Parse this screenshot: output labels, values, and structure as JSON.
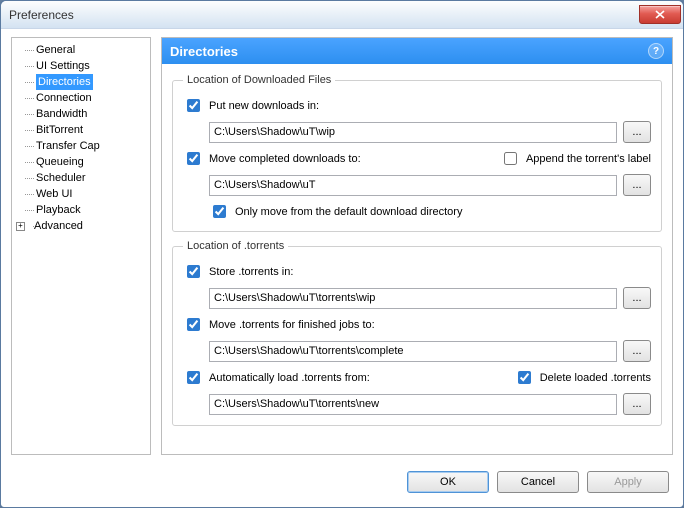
{
  "window": {
    "title": "Preferences"
  },
  "sidebar": {
    "items": [
      {
        "label": "General"
      },
      {
        "label": "UI Settings"
      },
      {
        "label": "Directories",
        "selected": true
      },
      {
        "label": "Connection"
      },
      {
        "label": "Bandwidth"
      },
      {
        "label": "BitTorrent"
      },
      {
        "label": "Transfer Cap"
      },
      {
        "label": "Queueing"
      },
      {
        "label": "Scheduler"
      },
      {
        "label": "Web UI"
      },
      {
        "label": "Playback"
      },
      {
        "label": "Advanced",
        "expandable": true
      }
    ]
  },
  "header": {
    "title": "Directories"
  },
  "section1": {
    "legend": "Location of Downloaded Files",
    "put_new": {
      "label": "Put new downloads in:",
      "checked": true
    },
    "put_new_path": "C:\\Users\\Shadow\\uT\\wip",
    "move_done": {
      "label": "Move completed downloads to:",
      "checked": true
    },
    "append_label": {
      "label": "Append the torrent's label",
      "checked": false
    },
    "move_done_path": "C:\\Users\\Shadow\\uT",
    "only_move": {
      "label": "Only move from the default download directory",
      "checked": true
    }
  },
  "section2": {
    "legend": "Location of .torrents",
    "store": {
      "label": "Store .torrents in:",
      "checked": true
    },
    "store_path": "C:\\Users\\Shadow\\uT\\torrents\\wip",
    "move_fin": {
      "label": "Move .torrents for finished jobs to:",
      "checked": true
    },
    "move_fin_path": "C:\\Users\\Shadow\\uT\\torrents\\complete",
    "auto_load": {
      "label": "Automatically load .torrents from:",
      "checked": true
    },
    "delete_loaded": {
      "label": "Delete loaded .torrents",
      "checked": true
    },
    "auto_load_path": "C:\\Users\\Shadow\\uT\\torrents\\new"
  },
  "buttons": {
    "browse": "...",
    "ok": "OK",
    "cancel": "Cancel",
    "apply": "Apply"
  }
}
